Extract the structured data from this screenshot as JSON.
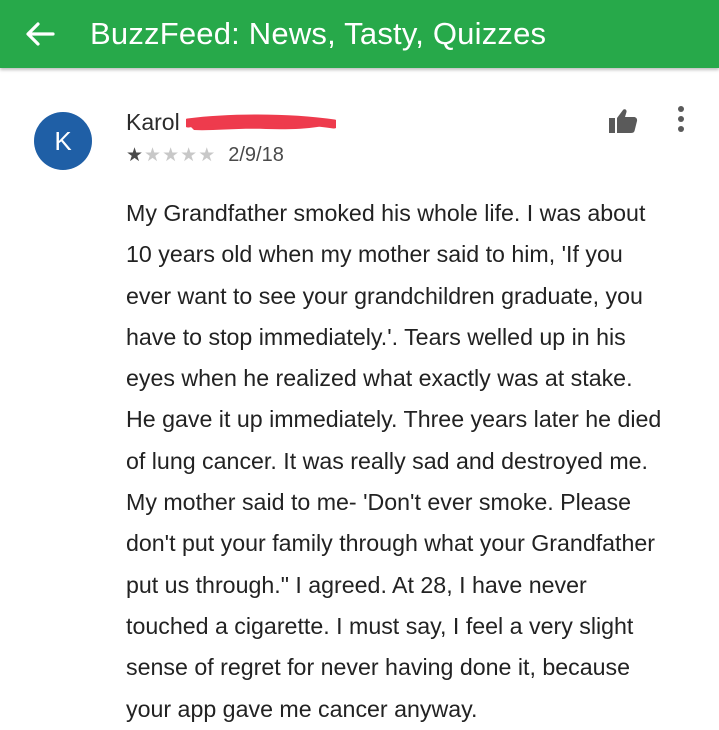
{
  "app_bar": {
    "title": "BuzzFeed: News, Tasty, Quizzes",
    "back_icon": "arrow-left-icon",
    "color": "#27a94a"
  },
  "review": {
    "avatar_letter": "K",
    "avatar_color": "#1f5fa6",
    "reviewer_name": "Karol",
    "redaction_color": "#ee3b4d",
    "rating": 1,
    "max_rating": 5,
    "date": "2/9/18",
    "actions": {
      "helpful_icon": "thumbs-up-icon",
      "more_icon": "more-vert-icon"
    },
    "body_lines": [
      "My Grandfather smoked his whole life. I was about",
      "10 years old when my mother said to him, 'If you",
      "ever want to see your grandchildren graduate, you",
      "have to stop immediately.'. Tears welled up in his",
      "eyes when he realized what exactly was at stake.",
      "He gave it up immediately. Three years later he died",
      "of lung cancer. It was really sad and destroyed me.",
      "My mother said to me- 'Don't ever smoke. Please",
      "don't put your family through what your Grandfather",
      "put us through.\" I agreed. At 28, I have never",
      "touched a cigarette. I must say, I feel a very slight",
      "sense of regret for never having done it, because",
      "your app gave me cancer anyway."
    ]
  }
}
